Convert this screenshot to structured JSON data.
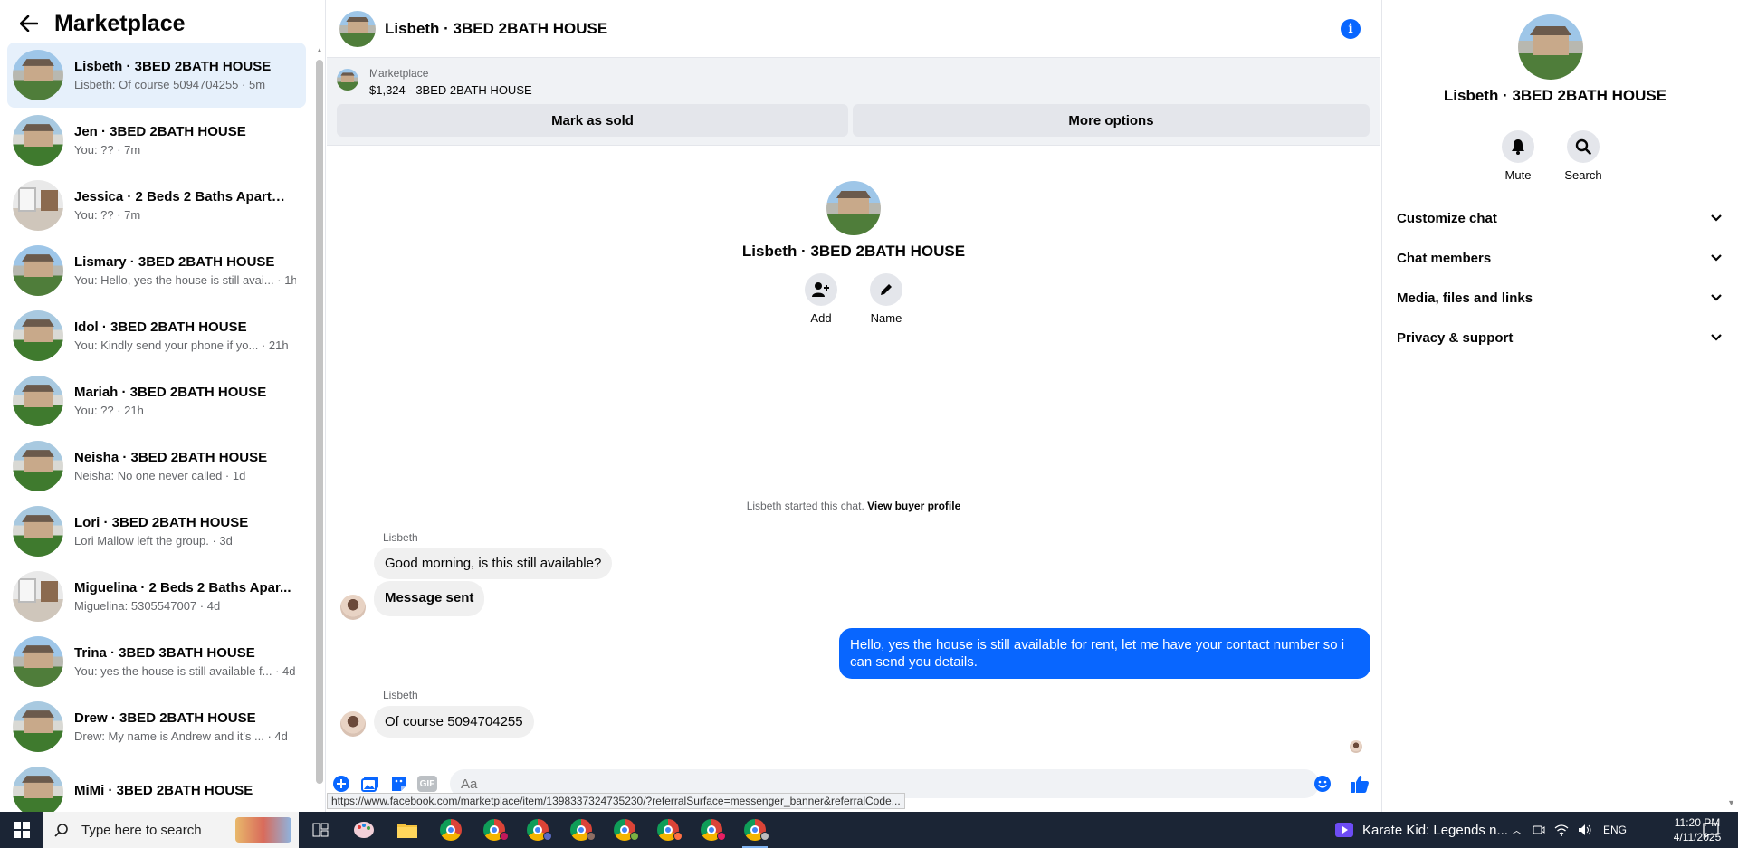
{
  "sidebar": {
    "title": "Marketplace",
    "conversations": [
      {
        "name": "Lisbeth · 3BED 2BATH HOUSE",
        "preview": "Lisbeth: Of course 5094704255 · 5m",
        "thumb": "house",
        "active": true
      },
      {
        "name": "Jen · 3BED 2BATH HOUSE",
        "preview": "You: ?? · 7m",
        "thumb": "house-green"
      },
      {
        "name": "Jessica · 2 Beds 2 Baths Apartme...",
        "preview": "You: ?? · 7m",
        "thumb": "interior"
      },
      {
        "name": "Lismary · 3BED 2BATH HOUSE",
        "preview": "You: Hello, yes the house is still avai... · 1h",
        "thumb": "house"
      },
      {
        "name": "Idol · 3BED 2BATH HOUSE",
        "preview": "You: Kindly send your phone if yo... · 21h",
        "thumb": "house-green"
      },
      {
        "name": "Mariah · 3BED 2BATH HOUSE",
        "preview": "You: ?? · 21h",
        "thumb": "house-green"
      },
      {
        "name": "Neisha · 3BED 2BATH HOUSE",
        "preview": "Neisha: No one never called · 1d",
        "thumb": "house-green"
      },
      {
        "name": "Lori · 3BED 2BATH HOUSE",
        "preview": "Lori Mallow left the group. · 3d",
        "thumb": "house-green"
      },
      {
        "name": "Miguelina · 2 Beds 2 Baths Apar...",
        "preview": "Miguelina: 5305547007 · 4d",
        "thumb": "interior"
      },
      {
        "name": "Trina · 3BED 3BATH HOUSE",
        "preview": "You: yes the house is still available f... · 4d",
        "thumb": "house"
      },
      {
        "name": "Drew · 3BED 2BATH HOUSE",
        "preview": "Drew: My name is Andrew and it's ... · 4d",
        "thumb": "house-green"
      },
      {
        "name": "MiMi · 3BED 2BATH HOUSE",
        "preview": "",
        "thumb": "house-green"
      }
    ]
  },
  "chat": {
    "title": "Lisbeth · 3BED 2BATH HOUSE",
    "banner": {
      "label": "Marketplace",
      "item": "$1,324 - 3BED 2BATH HOUSE",
      "mark_sold": "Mark as sold",
      "more_options": "More options"
    },
    "profile": {
      "name": "Lisbeth · 3BED 2BATH HOUSE",
      "add_label": "Add",
      "name_label": "Name"
    },
    "started_text": "Lisbeth started this chat.",
    "view_profile": "View buyer profile",
    "messages": [
      {
        "sender": "Lisbeth",
        "text": "Good morning, is this still available?"
      },
      {
        "text": "Message sent"
      },
      {
        "text": "Hello, yes the house is still available for rent, let me have your contact number so i can send you details.",
        "me": true
      },
      {
        "sender": "Lisbeth",
        "text": "Of course 5094704255"
      }
    ],
    "composer_placeholder": "Aa",
    "gif_label": "GIF",
    "status_url": "https://www.facebook.com/marketplace/item/1398337324735230/?referralSurface=messenger_banner&referralCode..."
  },
  "right_panel": {
    "name": "Lisbeth · 3BED 2BATH HOUSE",
    "mute_label": "Mute",
    "search_label": "Search",
    "sections": [
      "Customize chat",
      "Chat members",
      "Media, files and links",
      "Privacy & support"
    ]
  },
  "taskbar": {
    "search_placeholder": "Type here to search",
    "media_title": "Karate Kid: Legends n...",
    "language": "ENG",
    "time": "11:20 PM",
    "date": "4/11/2025"
  },
  "colors": {
    "accent": "#0866ff",
    "active_conv": "#e6f0fb",
    "taskbar": "#1b2535"
  }
}
